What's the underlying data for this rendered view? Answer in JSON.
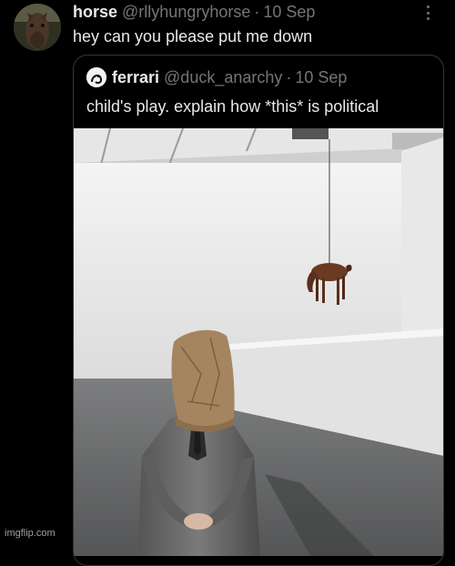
{
  "tweet": {
    "display_name": "horse",
    "handle": "@rllyhungryhorse",
    "separator": "·",
    "date": "10 Sep",
    "text": "hey can you please put me down",
    "avatar_icon": "horse-avatar-icon",
    "more_icon": "more-options-icon"
  },
  "quote": {
    "display_name": "ferrari",
    "handle": "@duck_anarchy",
    "separator": "·",
    "date": "10 Sep",
    "text": "child's play. explain how *this* is political",
    "avatar_icon": "ferrari-avatar-icon",
    "media_description_icon": "gallery-photo-image"
  },
  "watermark": "imgflip.com",
  "colors": {
    "background": "#000000",
    "text": "#e7e9ea",
    "muted": "#71767b",
    "border": "#333639"
  }
}
